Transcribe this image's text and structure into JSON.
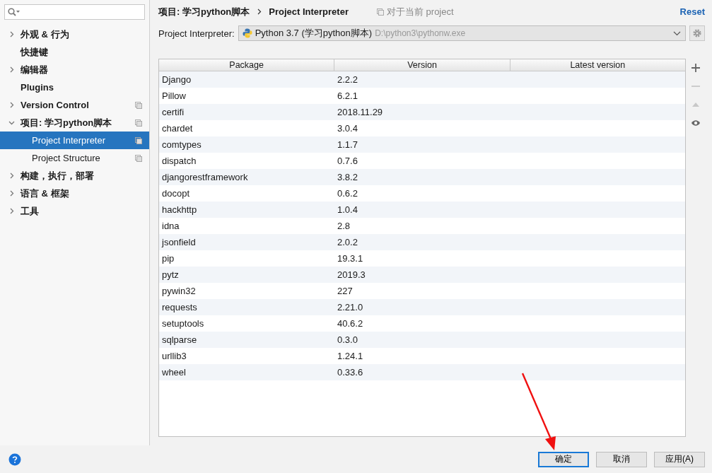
{
  "sidebar": {
    "items": [
      {
        "label": "外观 & 行为",
        "expanded": false,
        "project_scoped": false
      },
      {
        "label": "快捷键",
        "project_scoped": false
      },
      {
        "label": "编辑器",
        "expanded": false,
        "project_scoped": false
      },
      {
        "label": "Plugins",
        "project_scoped": false
      },
      {
        "label": "Version Control",
        "expanded": false,
        "project_scoped": true
      },
      {
        "label": "项目: 学习python脚本",
        "expanded": true,
        "project_scoped": true,
        "children": [
          {
            "label": "Project Interpreter",
            "selected": true,
            "project_scoped": true
          },
          {
            "label": "Project Structure",
            "selected": false,
            "project_scoped": true
          }
        ]
      },
      {
        "label": "构建，执行，部署",
        "expanded": false,
        "project_scoped": false
      },
      {
        "label": "语言 & 框架",
        "expanded": false,
        "project_scoped": false
      },
      {
        "label": "工具",
        "expanded": false,
        "project_scoped": false
      }
    ]
  },
  "breadcrumb": [
    "项目: 学习python脚本",
    "Project Interpreter"
  ],
  "scope_note": "对于当前 project",
  "reset_link": "Reset",
  "interpreter": {
    "label": "Project Interpreter:",
    "name": "Python 3.7 (学习python脚本)",
    "path": "D:\\python3\\pythonw.exe"
  },
  "table": {
    "columns": [
      "Package",
      "Version",
      "Latest version"
    ],
    "rows": [
      [
        "Django",
        "2.2.2",
        ""
      ],
      [
        "Pillow",
        "6.2.1",
        ""
      ],
      [
        "certifi",
        "2018.11.29",
        ""
      ],
      [
        "chardet",
        "3.0.4",
        ""
      ],
      [
        "comtypes",
        "1.1.7",
        ""
      ],
      [
        "dispatch",
        "0.7.6",
        ""
      ],
      [
        "djangorestframework",
        "3.8.2",
        ""
      ],
      [
        "docopt",
        "0.6.2",
        ""
      ],
      [
        "hackhttp",
        "1.0.4",
        ""
      ],
      [
        "idna",
        "2.8",
        ""
      ],
      [
        "jsonfield",
        "2.0.2",
        ""
      ],
      [
        "pip",
        "19.3.1",
        ""
      ],
      [
        "pytz",
        "2019.3",
        ""
      ],
      [
        "pywin32",
        "227",
        ""
      ],
      [
        "requests",
        "2.21.0",
        ""
      ],
      [
        "setuptools",
        "40.6.2",
        ""
      ],
      [
        "sqlparse",
        "0.3.0",
        ""
      ],
      [
        "urllib3",
        "1.24.1",
        ""
      ],
      [
        "wheel",
        "0.33.6",
        ""
      ]
    ]
  },
  "table_tools": [
    {
      "kind": "add",
      "disabled": false
    },
    {
      "kind": "remove",
      "disabled": true
    },
    {
      "kind": "upgrade",
      "disabled": true
    },
    {
      "kind": "show",
      "disabled": false
    }
  ],
  "buttons": [
    {
      "label": "确定",
      "focused": true
    },
    {
      "label": "取消",
      "focused": false
    },
    {
      "label": "应用(A)",
      "focused": false
    }
  ],
  "annotations": [
    {
      "kind": "arrow"
    }
  ]
}
